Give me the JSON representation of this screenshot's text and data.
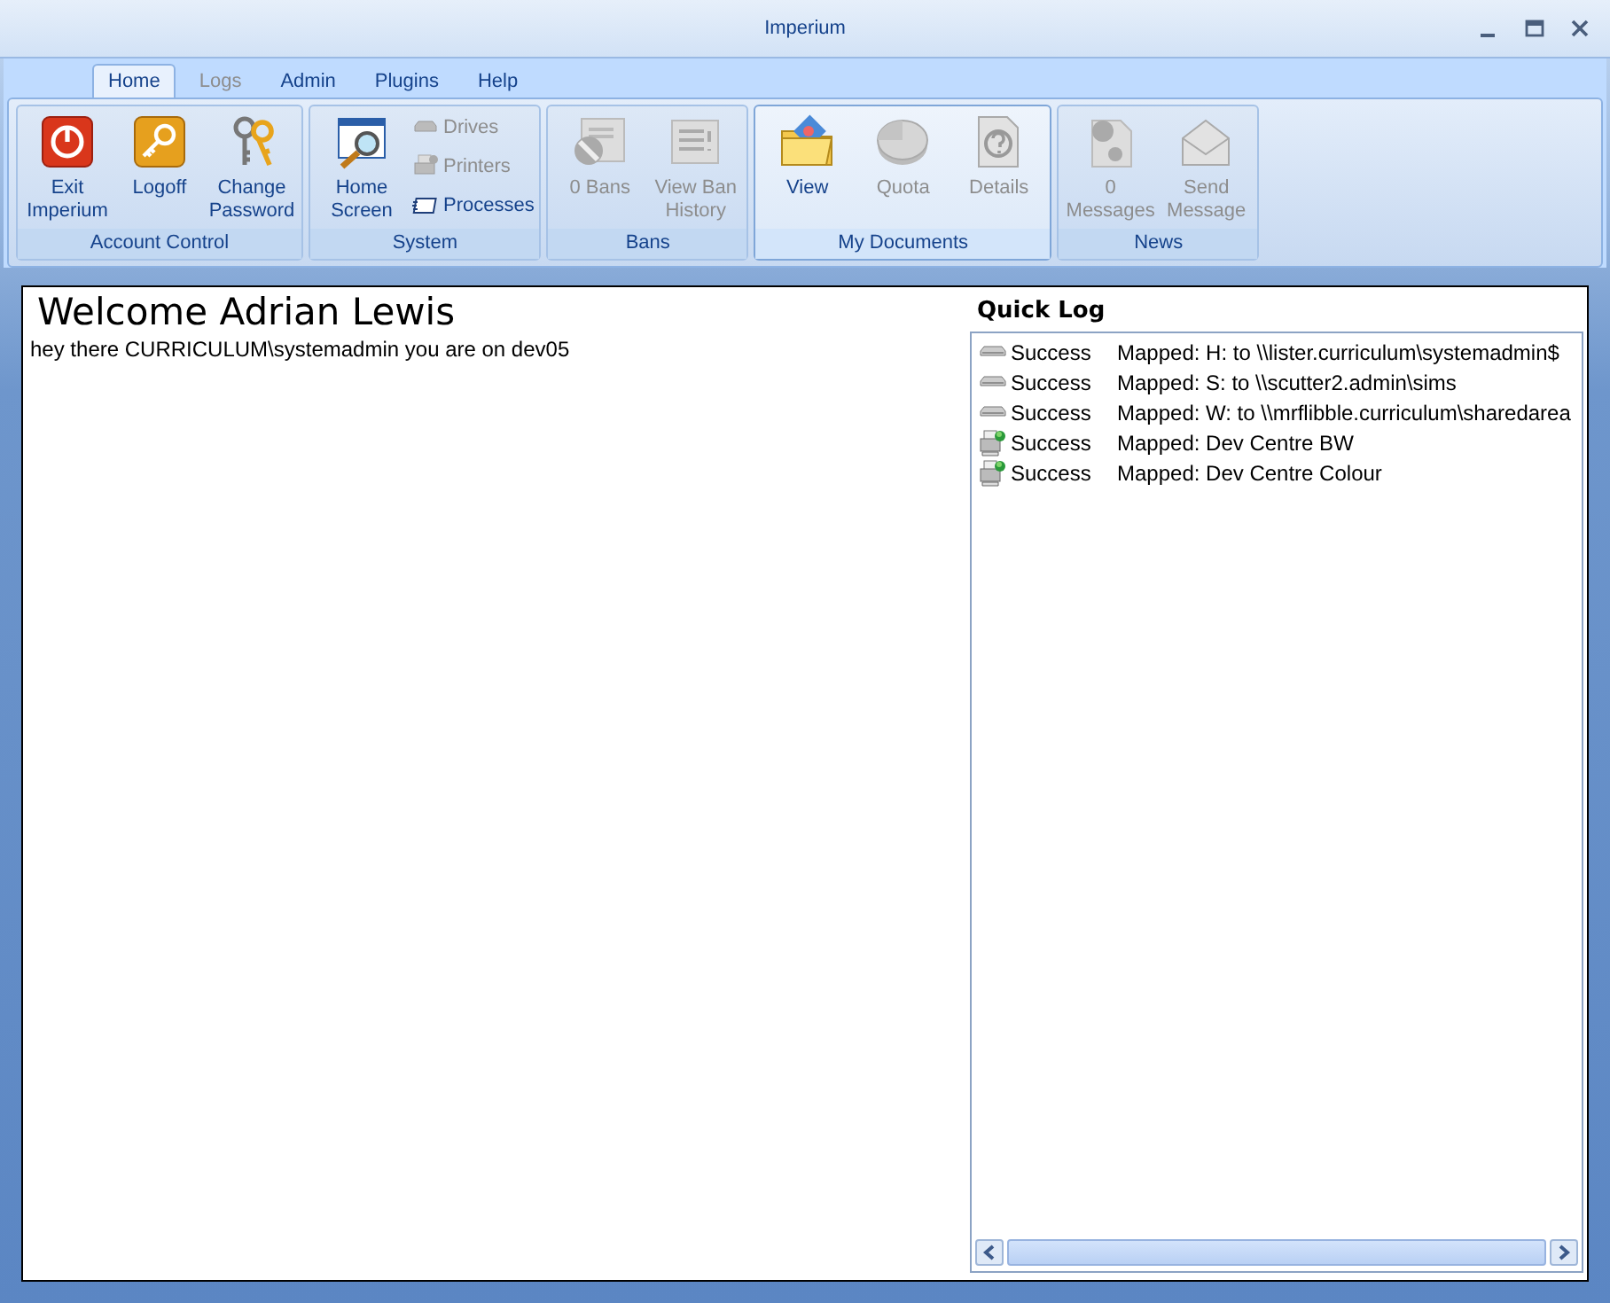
{
  "window": {
    "title": "Imperium"
  },
  "tabs": [
    {
      "label": "Home",
      "selected": true,
      "disabled": false
    },
    {
      "label": "Logs",
      "selected": false,
      "disabled": true
    },
    {
      "label": "Admin",
      "selected": false,
      "disabled": false
    },
    {
      "label": "Plugins",
      "selected": false,
      "disabled": false
    },
    {
      "label": "Help",
      "selected": false,
      "disabled": false
    }
  ],
  "ribbon_groups": [
    {
      "title": "Account Control",
      "highlighted": false,
      "buttons": [
        {
          "kind": "large",
          "label": "Exit Imperium",
          "disabled": false
        },
        {
          "kind": "large",
          "label": "Logoff",
          "disabled": false
        },
        {
          "kind": "large",
          "label": "Change Password",
          "disabled": false
        }
      ]
    },
    {
      "title": "System",
      "highlighted": false,
      "buttons": [
        {
          "kind": "large",
          "label": "Home Screen",
          "disabled": false
        },
        {
          "kind": "small",
          "label": "Drives",
          "disabled": true
        },
        {
          "kind": "small",
          "label": "Printers",
          "disabled": true
        },
        {
          "kind": "small",
          "label": "Processes",
          "disabled": false
        }
      ]
    },
    {
      "title": "Bans",
      "highlighted": false,
      "buttons": [
        {
          "kind": "large",
          "label": "0 Bans",
          "disabled": true
        },
        {
          "kind": "large",
          "label": "View Ban History",
          "disabled": true
        }
      ]
    },
    {
      "title": "My Documents",
      "highlighted": true,
      "buttons": [
        {
          "kind": "large",
          "label": "View",
          "disabled": false
        },
        {
          "kind": "large",
          "label": "Quota",
          "disabled": true
        },
        {
          "kind": "large",
          "label": "Details",
          "disabled": true
        }
      ]
    },
    {
      "title": "News",
      "highlighted": false,
      "buttons": [
        {
          "kind": "large",
          "label": "0 Messages",
          "disabled": true
        },
        {
          "kind": "large",
          "label": "Send Message",
          "disabled": true
        }
      ]
    }
  ],
  "welcome": {
    "heading": "Welcome Adrian Lewis",
    "message": "hey there CURRICULUM\\systemadmin you are on dev05"
  },
  "quick_log": {
    "title": "Quick Log",
    "entries": [
      {
        "kind": "drive",
        "status": "Success",
        "message": "Mapped: H: to \\\\lister.curriculum\\systemadmin$"
      },
      {
        "kind": "drive",
        "status": "Success",
        "message": "Mapped: S: to \\\\scutter2.admin\\sims"
      },
      {
        "kind": "drive",
        "status": "Success",
        "message": "Mapped: W: to \\\\mrflibble.curriculum\\sharedarea"
      },
      {
        "kind": "printer",
        "status": "Success",
        "message": "Mapped: Dev Centre BW"
      },
      {
        "kind": "printer",
        "status": "Success",
        "message": "Mapped: Dev Centre Colour"
      }
    ]
  }
}
